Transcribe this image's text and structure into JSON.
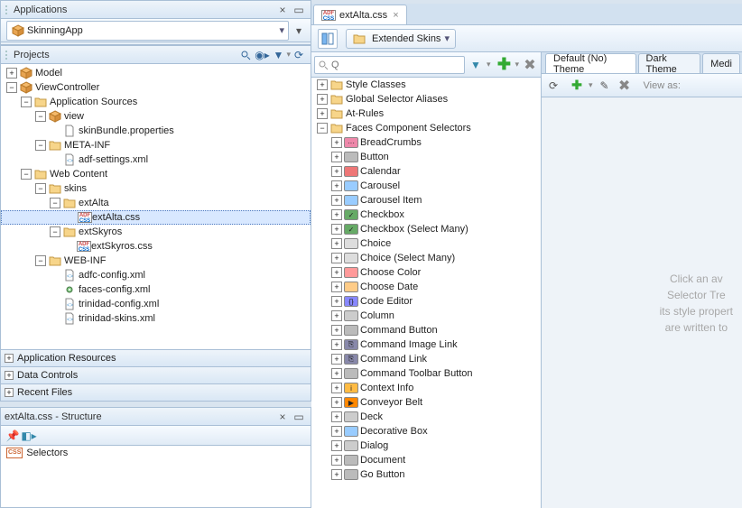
{
  "applications": {
    "title": "Applications",
    "combo_text": "SkinningApp"
  },
  "projects": {
    "title": "Projects",
    "tree": [
      {
        "lvl": 0,
        "type": "exp-closed",
        "icon": "cube",
        "label": "Model"
      },
      {
        "lvl": 0,
        "type": "exp-open",
        "icon": "cube",
        "label": "ViewController"
      },
      {
        "lvl": 1,
        "type": "exp-open",
        "icon": "folder",
        "label": "Application Sources"
      },
      {
        "lvl": 2,
        "type": "exp-open",
        "icon": "cube",
        "label": "view"
      },
      {
        "lvl": 3,
        "type": "leaf",
        "icon": "file",
        "label": "skinBundle.properties"
      },
      {
        "lvl": 2,
        "type": "exp-open",
        "icon": "folder",
        "label": "META-INF"
      },
      {
        "lvl": 3,
        "type": "leaf",
        "icon": "xml",
        "label": "adf-settings.xml"
      },
      {
        "lvl": 1,
        "type": "exp-open",
        "icon": "folder",
        "label": "Web Content"
      },
      {
        "lvl": 2,
        "type": "exp-open",
        "icon": "folder",
        "label": "skins"
      },
      {
        "lvl": 3,
        "type": "exp-open",
        "icon": "folder",
        "label": "extAlta"
      },
      {
        "lvl": 4,
        "type": "leaf",
        "icon": "adfcss",
        "label": "extAlta.css",
        "selected": true
      },
      {
        "lvl": 3,
        "type": "exp-open",
        "icon": "folder",
        "label": "extSkyros"
      },
      {
        "lvl": 4,
        "type": "leaf",
        "icon": "adfcss",
        "label": "extSkyros.css"
      },
      {
        "lvl": 2,
        "type": "exp-open",
        "icon": "folder",
        "label": "WEB-INF"
      },
      {
        "lvl": 3,
        "type": "leaf",
        "icon": "xml",
        "label": "adfc-config.xml"
      },
      {
        "lvl": 3,
        "type": "leaf",
        "icon": "gear",
        "label": "faces-config.xml"
      },
      {
        "lvl": 3,
        "type": "leaf",
        "icon": "xml",
        "label": "trinidad-config.xml"
      },
      {
        "lvl": 3,
        "type": "leaf",
        "icon": "xml",
        "label": "trinidad-skins.xml"
      }
    ]
  },
  "accordions": [
    "Application Resources",
    "Data Controls",
    "Recent Files"
  ],
  "structure": {
    "title": "extAlta.css - Structure",
    "root": "Selectors"
  },
  "editor": {
    "tab": "extAlta.css",
    "dropdown": "Extended Skins"
  },
  "selectorTree": [
    {
      "lvl": 0,
      "type": "exp-closed",
      "icon": "folder",
      "label": "Style Classes"
    },
    {
      "lvl": 0,
      "type": "exp-closed",
      "icon": "folder",
      "label": "Global Selector Aliases"
    },
    {
      "lvl": 0,
      "type": "exp-closed",
      "icon": "folder",
      "label": "At-Rules"
    },
    {
      "lvl": 0,
      "type": "exp-open",
      "icon": "folder",
      "label": "Faces Component Selectors"
    },
    {
      "lvl": 1,
      "type": "exp-closed",
      "icon": "bread",
      "label": "BreadCrumbs"
    },
    {
      "lvl": 1,
      "type": "exp-closed",
      "icon": "btn",
      "label": "Button"
    },
    {
      "lvl": 1,
      "type": "exp-closed",
      "icon": "cal",
      "label": "Calendar"
    },
    {
      "lvl": 1,
      "type": "exp-closed",
      "icon": "car",
      "label": "Carousel"
    },
    {
      "lvl": 1,
      "type": "exp-closed",
      "icon": "car",
      "label": "Carousel Item"
    },
    {
      "lvl": 1,
      "type": "exp-closed",
      "icon": "chk",
      "label": "Checkbox"
    },
    {
      "lvl": 1,
      "type": "exp-closed",
      "icon": "chk",
      "label": "Checkbox (Select Many)"
    },
    {
      "lvl": 1,
      "type": "exp-closed",
      "icon": "choice",
      "label": "Choice"
    },
    {
      "lvl": 1,
      "type": "exp-closed",
      "icon": "choice",
      "label": "Choice (Select Many)"
    },
    {
      "lvl": 1,
      "type": "exp-closed",
      "icon": "color",
      "label": "Choose Color"
    },
    {
      "lvl": 1,
      "type": "exp-closed",
      "icon": "date",
      "label": "Choose Date"
    },
    {
      "lvl": 1,
      "type": "exp-closed",
      "icon": "code",
      "label": "Code Editor"
    },
    {
      "lvl": 1,
      "type": "exp-closed",
      "icon": "col",
      "label": "Column"
    },
    {
      "lvl": 1,
      "type": "exp-closed",
      "icon": "btn",
      "label": "Command Button"
    },
    {
      "lvl": 1,
      "type": "exp-closed",
      "icon": "link",
      "label": "Command Image Link"
    },
    {
      "lvl": 1,
      "type": "exp-closed",
      "icon": "link",
      "label": "Command Link"
    },
    {
      "lvl": 1,
      "type": "exp-closed",
      "icon": "btn",
      "label": "Command Toolbar Button"
    },
    {
      "lvl": 1,
      "type": "exp-closed",
      "icon": "info",
      "label": "Context Info"
    },
    {
      "lvl": 1,
      "type": "exp-closed",
      "icon": "conv",
      "label": "Conveyor Belt"
    },
    {
      "lvl": 1,
      "type": "exp-closed",
      "icon": "deck",
      "label": "Deck"
    },
    {
      "lvl": 1,
      "type": "exp-closed",
      "icon": "box",
      "label": "Decorative Box"
    },
    {
      "lvl": 1,
      "type": "exp-closed",
      "icon": "dlg",
      "label": "Dialog"
    },
    {
      "lvl": 1,
      "type": "exp-closed",
      "icon": "doc",
      "label": "Document"
    },
    {
      "lvl": 1,
      "type": "exp-closed",
      "icon": "btn",
      "label": "Go Button"
    }
  ],
  "themes": {
    "tabs": [
      "Default (No) Theme",
      "Dark Theme",
      "Medi"
    ],
    "viewAs": "View as:",
    "hint": [
      "Click an av",
      "Selector Tre",
      "its style propert",
      "are written to"
    ]
  },
  "icons": {
    "search": "Q"
  }
}
